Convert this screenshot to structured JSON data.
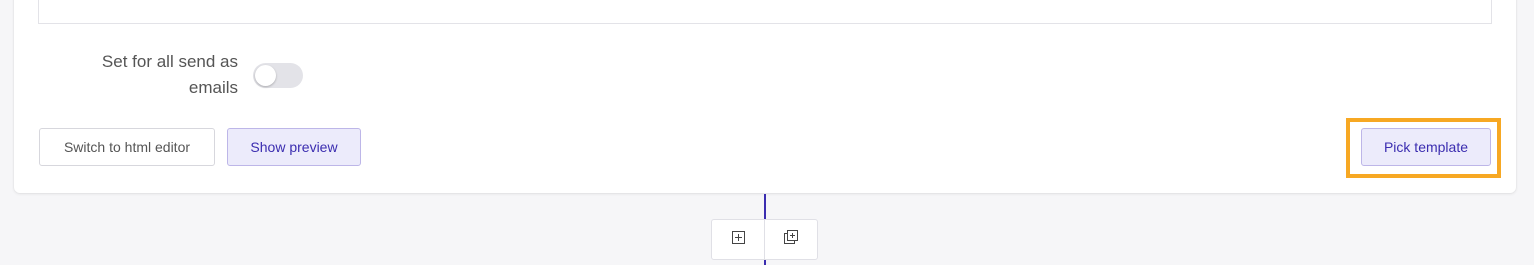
{
  "settings": {
    "send_as_label": "Set for all send as emails",
    "send_as_enabled": false
  },
  "actions": {
    "switch_editor_label": "Switch to html editor",
    "show_preview_label": "Show preview",
    "pick_template_label": "Pick template"
  },
  "toolbar": {
    "add_block_icon": "plus-square-icon",
    "duplicate_block_icon": "duplicate-plus-icon"
  },
  "colors": {
    "accent": "#3b2db0",
    "accent_bg": "#ecebfb",
    "highlight": "#f7a823"
  }
}
